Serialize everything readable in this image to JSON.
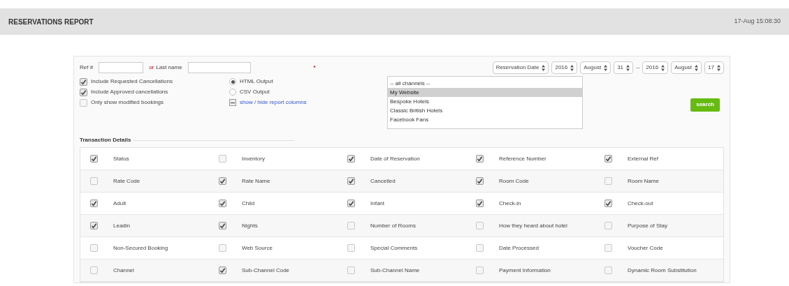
{
  "header": {
    "title": "RESERVATIONS REPORT",
    "timestamp": "17-Aug 15:08:30"
  },
  "filters": {
    "ref_label": "Ref #",
    "or_label": "or",
    "last_name_label": "Last name",
    "required_mark": "*",
    "date_type": "Reservation Date",
    "from": {
      "year": "2016",
      "month": "August",
      "day": "31"
    },
    "separator": "--",
    "to": {
      "year": "2016",
      "month": "August",
      "day": "17"
    }
  },
  "options": [
    {
      "label": "Include Requested Cancellations",
      "checked": true
    },
    {
      "label": "Include Approved cancellations",
      "checked": true
    },
    {
      "label": "Only show modified bookings",
      "checked": false
    }
  ],
  "output": [
    {
      "label": "HTML Output",
      "selected": true
    },
    {
      "label": "CSV Output",
      "selected": false
    }
  ],
  "columns_toggle": {
    "label": "show / hide report columns",
    "expanded": true
  },
  "channels": [
    {
      "label": "-- all channels --",
      "selected": false
    },
    {
      "label": "My Website",
      "selected": true
    },
    {
      "label": "Bespoke Hotels",
      "selected": false
    },
    {
      "label": "Classic British Hotels",
      "selected": false
    },
    {
      "label": "Facebook Fans",
      "selected": false
    }
  ],
  "search_button": "search",
  "transaction_details": {
    "title": "Transaction Details",
    "rows": [
      [
        {
          "label": "Status",
          "checked": true
        },
        {
          "label": "Inventory",
          "checked": false
        },
        {
          "label": "Date of Reservation",
          "checked": true
        },
        {
          "label": "Reference Number",
          "checked": true
        },
        {
          "label": "External Ref",
          "checked": true
        }
      ],
      [
        {
          "label": "Rate Code",
          "checked": false
        },
        {
          "label": "Rate Name",
          "checked": true
        },
        {
          "label": "Cancelled",
          "checked": true
        },
        {
          "label": "Room Code",
          "checked": true
        },
        {
          "label": "Room Name",
          "checked": false
        }
      ],
      [
        {
          "label": "Adult",
          "checked": true
        },
        {
          "label": "Child",
          "checked": true
        },
        {
          "label": "Infant",
          "checked": true
        },
        {
          "label": "Check-in",
          "checked": true
        },
        {
          "label": "Check-out",
          "checked": true
        }
      ],
      [
        {
          "label": "Leadin",
          "checked": true
        },
        {
          "label": "Nights",
          "checked": true
        },
        {
          "label": "Number of Rooms",
          "checked": false
        },
        {
          "label": "How they heard about hotel",
          "checked": false
        },
        {
          "label": "Purpose of Stay",
          "checked": false
        }
      ],
      [
        {
          "label": "Non-Secured Booking",
          "checked": false
        },
        {
          "label": "Web Source",
          "checked": false
        },
        {
          "label": "Special Comments",
          "checked": false
        },
        {
          "label": "Date Processed",
          "checked": false
        },
        {
          "label": "Voucher Code",
          "checked": false
        }
      ],
      [
        {
          "label": "Channel",
          "checked": false
        },
        {
          "label": "Sub-Channel Code",
          "checked": true
        },
        {
          "label": "Sub-Channel Name",
          "checked": false
        },
        {
          "label": "Payment Information",
          "checked": false
        },
        {
          "label": "Dynamic Room Substitution",
          "checked": false
        }
      ]
    ]
  }
}
